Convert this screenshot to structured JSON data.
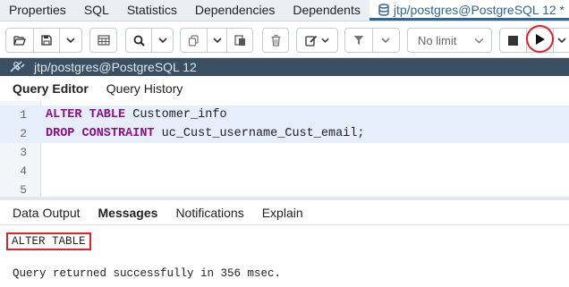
{
  "top_tabs": [
    {
      "label": "Properties"
    },
    {
      "label": "SQL"
    },
    {
      "label": "Statistics"
    },
    {
      "label": "Dependencies"
    },
    {
      "label": "Dependents"
    },
    {
      "label": "jtp/postgres@PostgreSQL 12 *"
    }
  ],
  "toolbar": {
    "limit_label": "No limit",
    "icons": [
      "open-file-icon",
      "save-icon",
      "chevron-down-icon",
      "table-view-icon",
      "search-icon",
      "chevron-down-icon",
      "copy-icon",
      "chevron-down-icon",
      "paste-row-icon",
      "delete-icon",
      "edit-icon",
      "chevron-down-icon",
      "filter-icon",
      "chevron-down-icon",
      "stop-icon",
      "execute-icon",
      "chevron-down-icon"
    ],
    "highlight_color": "#d9262c"
  },
  "connection": {
    "label": "jtp/postgres@PostgreSQL 12"
  },
  "query_tabs": [
    {
      "label": "Query Editor"
    },
    {
      "label": "Query History"
    }
  ],
  "editor": {
    "lines": [
      {
        "num": "1",
        "kw": "ALTER TABLE",
        "rest": " Customer_info"
      },
      {
        "num": "2",
        "kw": "DROP CONSTRAINT",
        "rest": " uc_Cust_username_Cust_email;"
      },
      {
        "num": "3",
        "kw": "",
        "rest": ""
      },
      {
        "num": "4",
        "kw": "",
        "rest": ""
      },
      {
        "num": "5",
        "kw": "",
        "rest": ""
      }
    ]
  },
  "output_tabs": [
    {
      "label": "Data Output"
    },
    {
      "label": "Messages"
    },
    {
      "label": "Notifications"
    },
    {
      "label": "Explain"
    }
  ],
  "messages": {
    "result": "ALTER TABLE",
    "status": "Query returned successfully in 356 msec."
  }
}
